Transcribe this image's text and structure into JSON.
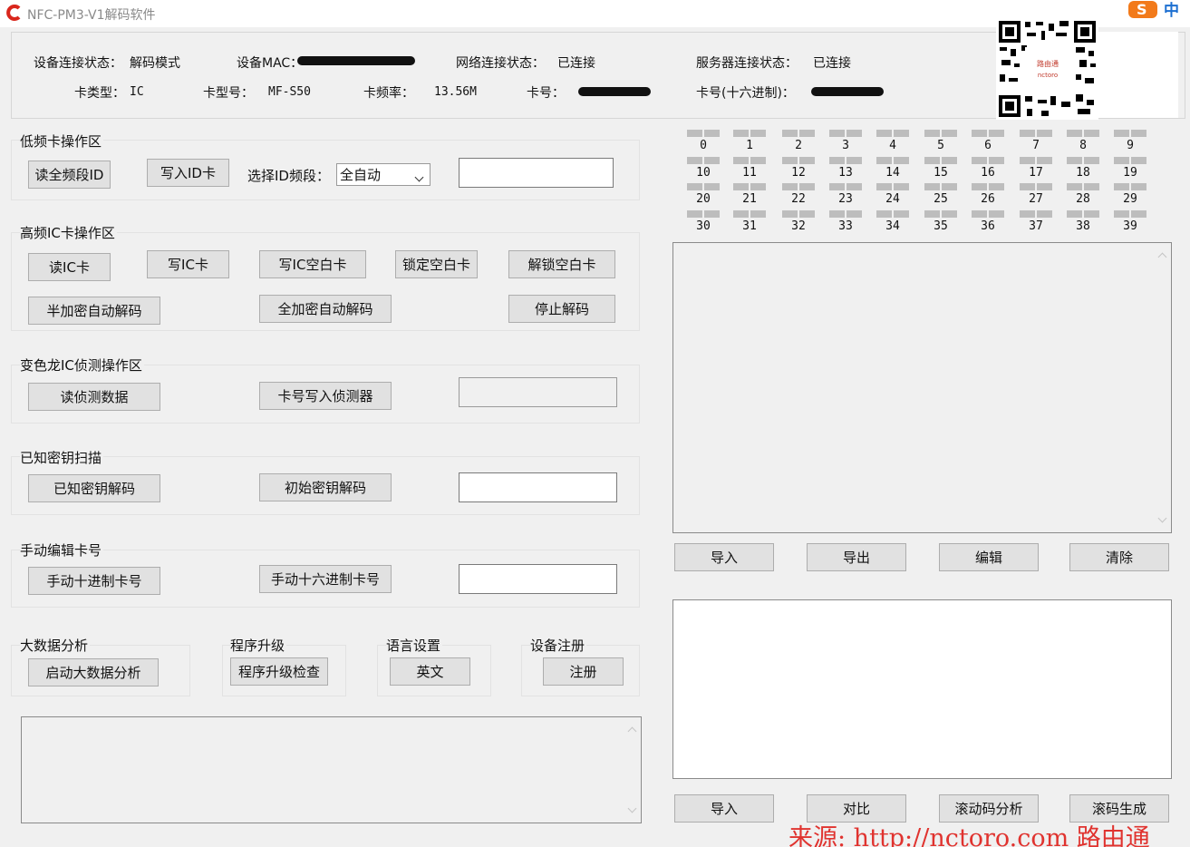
{
  "window": {
    "title": "NFC-PM3-V1解码软件",
    "ime_label": "中",
    "ime_logo": "S"
  },
  "status": {
    "device_conn_label": "设备连接状态：",
    "device_conn_value": "解码模式",
    "device_mac_label": "设备MAC：",
    "network_label": "网络连接状态：",
    "network_value": "已连接",
    "server_label": "服务器连接状态：",
    "server_value": "已连接",
    "card_type_label": "卡类型：",
    "card_type_value": "IC",
    "card_model_label": "卡型号：",
    "card_model_value": "MF-S50",
    "card_freq_label": "卡频率：",
    "card_freq_value": "13.56M",
    "card_no_label": "卡号：",
    "card_hex_label": "卡号(十六进制)："
  },
  "qr": {
    "caption_top": "路由通",
    "caption_bottom": "nctoro"
  },
  "groups": {
    "lf": {
      "title": "低频卡操作区",
      "read_all_band": "读全频段ID",
      "write_id": "写入ID卡",
      "select_band_label": "选择ID频段：",
      "select_band_value": "全自动"
    },
    "hf": {
      "title": "高频IC卡操作区",
      "read_ic": "读IC卡",
      "write_ic": "写IC卡",
      "write_blank": "写IC空白卡",
      "lock_blank": "锁定空白卡",
      "unlock_blank": "解锁空白卡",
      "half_encrypt": "半加密自动解码",
      "full_encrypt": "全加密自动解码",
      "stop_decode": "停止解码"
    },
    "chameleon": {
      "title": "变色龙IC侦测操作区",
      "read_detect": "读侦测数据",
      "write_detector": "卡号写入侦测器"
    },
    "known_key": {
      "title": "已知密钥扫描",
      "known_decode": "已知密钥解码",
      "initial_decode": "初始密钥解码"
    },
    "manual": {
      "title": "手动编辑卡号",
      "manual_dec": "手动十进制卡号",
      "manual_hex": "手动十六进制卡号"
    },
    "bigdata": {
      "title": "大数据分析",
      "start": "启动大数据分析"
    },
    "upgrade": {
      "title": "程序升级",
      "check": "程序升级检查"
    },
    "language": {
      "title": "语言设置",
      "english": "英文"
    },
    "register": {
      "title": "设备注册",
      "register": "注册"
    }
  },
  "sectors": [
    "0",
    "1",
    "2",
    "3",
    "4",
    "5",
    "6",
    "7",
    "8",
    "9",
    "10",
    "11",
    "12",
    "13",
    "14",
    "15",
    "16",
    "17",
    "18",
    "19",
    "20",
    "21",
    "22",
    "23",
    "24",
    "25",
    "26",
    "27",
    "28",
    "29",
    "30",
    "31",
    "32",
    "33",
    "34",
    "35",
    "36",
    "37",
    "38",
    "39"
  ],
  "right_buttons_1": {
    "import": "导入",
    "export": "导出",
    "edit": "编辑",
    "clear": "清除"
  },
  "right_buttons_2": {
    "import": "导入",
    "compare": "对比",
    "rolling_analysis": "滚动码分析",
    "rolling_generate": "滚码生成"
  },
  "watermark": "来源: http://nctoro.com 路由通",
  "colors": {
    "accent_red": "#e0332f",
    "button_bg": "#e1e1e1",
    "window_bg": "#f0f0f0"
  }
}
